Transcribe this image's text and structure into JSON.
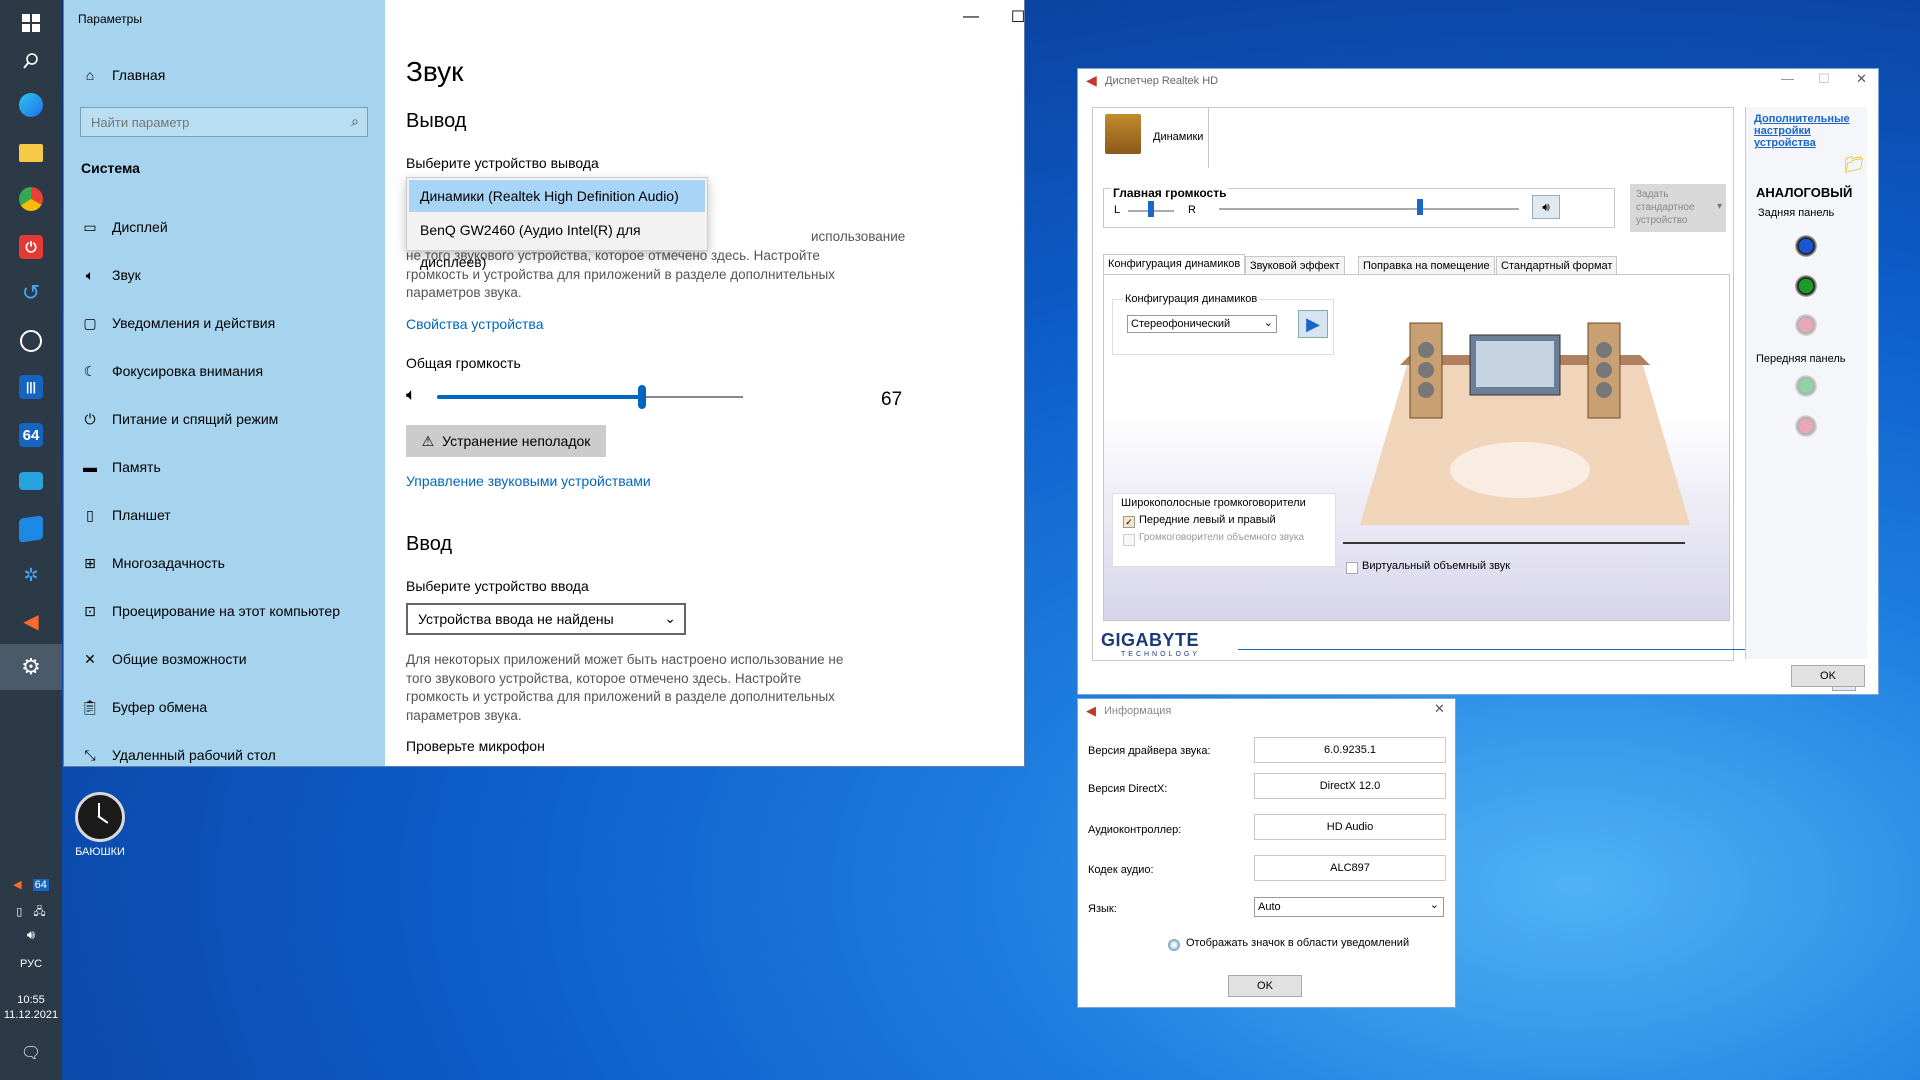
{
  "taskbar": {
    "apps": [
      {
        "name": "windows-start-icon"
      },
      {
        "name": "search-icon"
      },
      {
        "name": "edge-icon"
      },
      {
        "name": "file-explorer-icon"
      },
      {
        "name": "chrome-icon"
      },
      {
        "name": "power-app-icon"
      },
      {
        "name": "undo-app-icon"
      },
      {
        "name": "clock-app-icon"
      },
      {
        "name": "equalizer-app-icon"
      },
      {
        "name": "aida64-icon",
        "label": "64"
      },
      {
        "name": "monitor-app-icon"
      },
      {
        "name": "windows-tiles-icon"
      },
      {
        "name": "network-app-icon"
      },
      {
        "name": "speaker-app-icon"
      },
      {
        "name": "settings-gear-icon"
      }
    ],
    "tray_badge": "64",
    "language": "РУС",
    "time": "10:55",
    "date": "11.12.2021"
  },
  "desktop_icon": {
    "label": "БАЮШКИ"
  },
  "settings": {
    "window_title": "Параметры",
    "sidebar": {
      "home": "Главная",
      "search_placeholder": "Найти параметр",
      "section": "Система",
      "items": [
        {
          "label": "Дисплей",
          "icon": "display-icon"
        },
        {
          "label": "Звук",
          "icon": "sound-icon"
        },
        {
          "label": "Уведомления и действия",
          "icon": "notifications-icon"
        },
        {
          "label": "Фокусировка внимания",
          "icon": "moon-icon"
        },
        {
          "label": "Питание и спящий режим",
          "icon": "power-icon"
        },
        {
          "label": "Память",
          "icon": "storage-icon"
        },
        {
          "label": "Планшет",
          "icon": "tablet-icon"
        },
        {
          "label": "Многозадачность",
          "icon": "multitasking-icon"
        },
        {
          "label": "Проецирование на этот компьютер",
          "icon": "projecting-icon"
        },
        {
          "label": "Общие возможности",
          "icon": "shared-icon"
        },
        {
          "label": "Буфер обмена",
          "icon": "clipboard-icon"
        },
        {
          "label": "Удаленный рабочий стол",
          "icon": "remote-desktop-icon"
        }
      ]
    },
    "main": {
      "title": "Звук",
      "output_heading": "Вывод",
      "output_label": "Выберите устройство вывода",
      "output_options": [
        "Динамики (Realtek High Definition Audio)",
        "BenQ GW2460 (Аудио Intel(R) для дисплеев)"
      ],
      "output_note_line1": "использование",
      "output_note_rest": "не того звукового устройства, которое отмечено здесь. Настройте громкость и устройства для приложений в разделе дополнительных параметров звука.",
      "device_properties_link": "Свойства устройства",
      "volume_label": "Общая громкость",
      "volume_value": "67",
      "volume_fraction": 0.67,
      "troubleshoot_button": "Устранение неполадок",
      "manage_devices_link": "Управление звуковыми устройствами",
      "input_heading": "Ввод",
      "input_label": "Выберите устройство ввода",
      "input_selected": "Устройства ввода не найдены",
      "input_note": "Для некоторых приложений может быть настроено использование не того звукового устройства, которое отмечено здесь. Настройте громкость и устройства для приложений в разделе дополнительных параметров звука.",
      "mic_test_label": "Проверьте микрофон"
    }
  },
  "realtek": {
    "window_title": "Диспетчер Realtek HD",
    "device_tab": "Динамики",
    "main_volume_label": "Главная громкость",
    "left_label": "L",
    "right_label": "R",
    "balance_fraction": 0.5,
    "volume_fraction": 0.67,
    "set_default_button": "Задать стандартное устройство",
    "tabs": [
      "Конфигурация динамиков",
      "Звуковой эффект",
      "Поправка на помещение",
      "Стандартный формат"
    ],
    "speaker_config_label": "Конфигурация динамиков",
    "speaker_config_value": "Стереофонический",
    "fullrange_label": "Широкополосные громкоговорители",
    "front_lr": "Передние левый и правый",
    "surround": "Громкоговорители объемного звука",
    "virtual_surround": "Виртуальный объемный звук",
    "advanced_link": "Дополнительные настройки устройства",
    "analog": "АНАЛОГОВЫЙ",
    "rear_panel": "Задняя панель",
    "front_panel": "Передняя панель",
    "brand": "GIGABYTE",
    "brand_sub": "TECHNOLOGY",
    "ok": "OK",
    "colors": {
      "rear_jack_1": "#1a55d4",
      "rear_jack_2": "#1a9c2a",
      "rear_jack_3": "#e9a8b8",
      "front_jack_1": "#8fd4a4",
      "front_jack_2": "#e9a8b8",
      "accent": "#1b66c9"
    }
  },
  "info": {
    "window_title": "Информация",
    "rows": [
      {
        "label": "Версия драйвера звука:",
        "value": "6.0.9235.1"
      },
      {
        "label": "Версия DirectX:",
        "value": "DirectX 12.0"
      },
      {
        "label": "Аудиоконтроллер:",
        "value": "HD Audio"
      },
      {
        "label": "Кодек аудио:",
        "value": "ALC897"
      }
    ],
    "language_label": "Язык:",
    "language_value": "Auto",
    "tray_option": "Отображать значок в области уведомлений",
    "ok": "OK"
  }
}
